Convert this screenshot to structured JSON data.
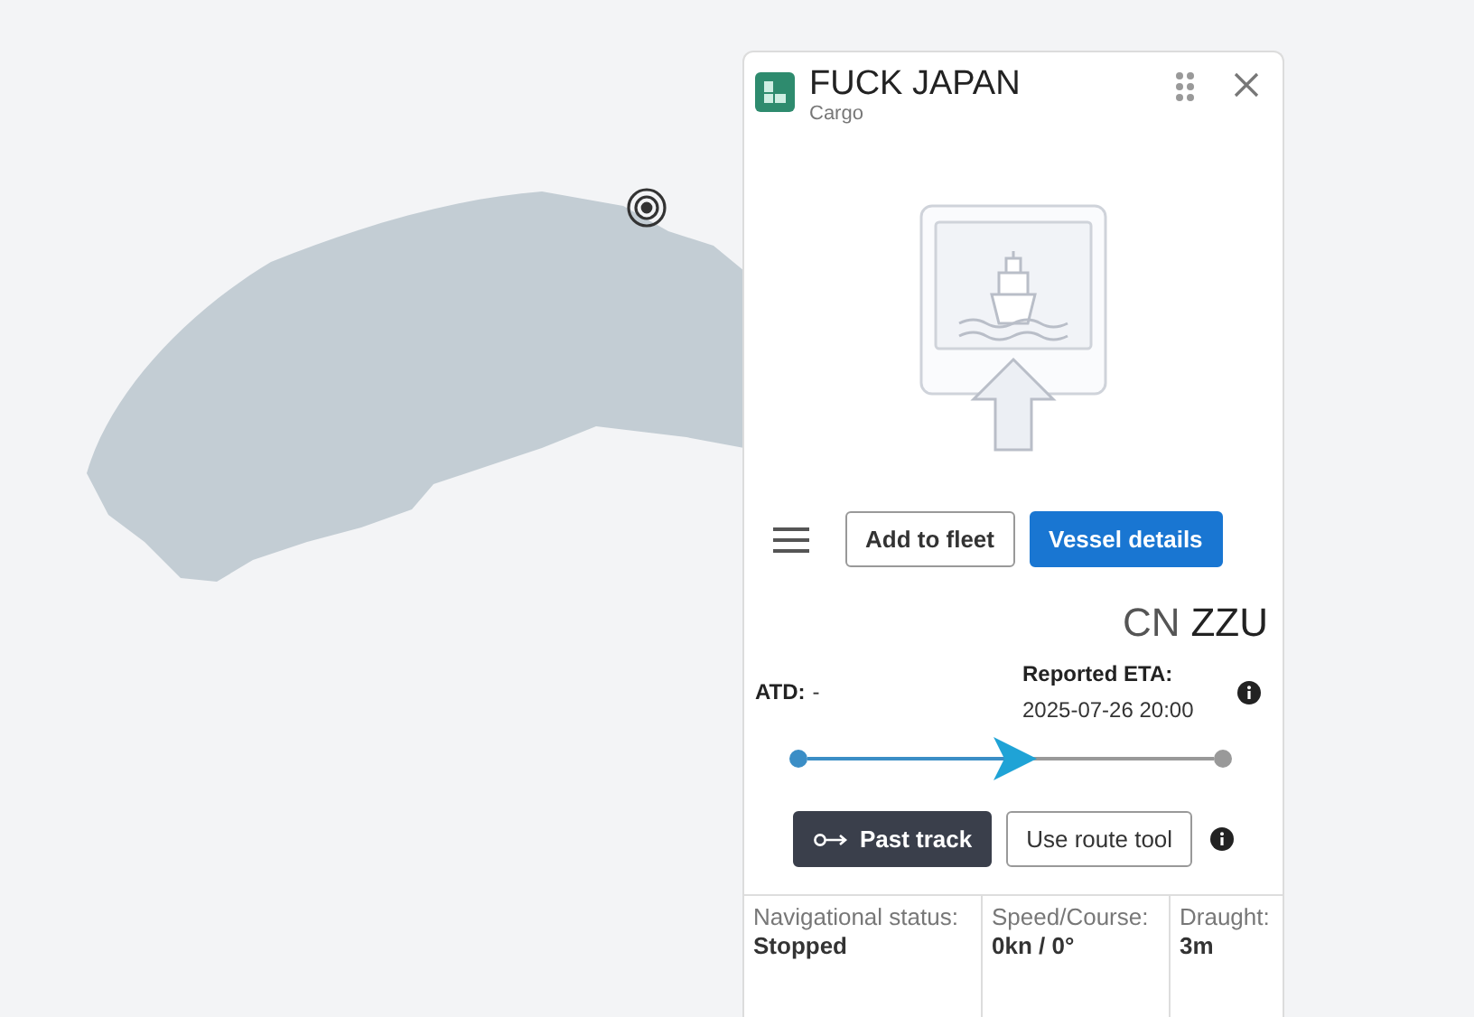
{
  "vessel": {
    "name": "FUCK JAPAN",
    "type": "Cargo"
  },
  "actions": {
    "add": "Add to fleet",
    "details": "Vessel details"
  },
  "flag": {
    "country": "CN",
    "code": "ZZU"
  },
  "voyage": {
    "atd_label": "ATD:",
    "atd_value": "-",
    "eta_label": "Reported ETA:",
    "eta_value": "2025-07-26 20:00",
    "progress": {
      "level": 0.51
    }
  },
  "track": {
    "past": "Past track",
    "route": "Use route tool"
  },
  "stats": [
    {
      "label": "Navigational status:",
      "value": "Stopped"
    },
    {
      "label": "Speed/Course:",
      "value": "0kn / 0°"
    },
    {
      "label": "Draught:",
      "value": "3m"
    }
  ]
}
